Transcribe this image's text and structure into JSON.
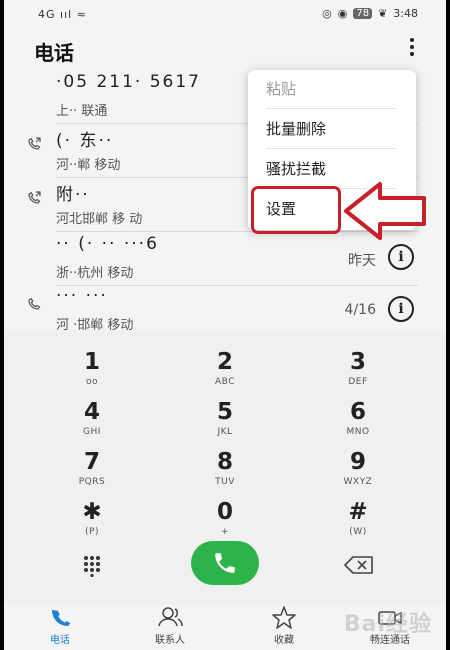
{
  "status_bar": {
    "left": "4G ııl ≈",
    "battery": "78",
    "time": "3:48"
  },
  "app": {
    "title": "电话"
  },
  "calls": [
    {
      "number": "·05 211· 5617",
      "location": "上·· 联通",
      "date": ""
    },
    {
      "number": "(· 东··",
      "location": "河··郸 移动",
      "date": ""
    },
    {
      "number": "附··",
      "location": "河北邯郸 移 动",
      "date": ""
    },
    {
      "number": "·· (· ·· ···6",
      "location": "浙··杭州 移动",
      "date": "昨天"
    },
    {
      "number": "··· ···",
      "location": "河 ·邯郸 移动",
      "date": "4/16"
    }
  ],
  "menu": {
    "items": [
      {
        "label": "粘贴",
        "disabled": true
      },
      {
        "label": "批量删除"
      },
      {
        "label": "骚扰拦截"
      },
      {
        "label": "设置"
      }
    ]
  },
  "keypad": [
    {
      "digit": "1",
      "letters": "oo"
    },
    {
      "digit": "2",
      "letters": "ABC"
    },
    {
      "digit": "3",
      "letters": "DEF"
    },
    {
      "digit": "4",
      "letters": "GHI"
    },
    {
      "digit": "5",
      "letters": "JKL"
    },
    {
      "digit": "6",
      "letters": "MNO"
    },
    {
      "digit": "7",
      "letters": "PQRS"
    },
    {
      "digit": "8",
      "letters": "TUV"
    },
    {
      "digit": "9",
      "letters": "WXYZ"
    },
    {
      "digit": "✱",
      "letters": "(P)"
    },
    {
      "digit": "0",
      "letters": "+"
    },
    {
      "digit": "#",
      "letters": "(W)"
    }
  ],
  "tabs": [
    {
      "label": "电话",
      "icon": "phone-icon",
      "active": true
    },
    {
      "label": "联系人",
      "icon": "contacts-icon"
    },
    {
      "label": "收藏",
      "icon": "star-icon"
    },
    {
      "label": "畅连通话",
      "icon": "video-call-icon"
    }
  ],
  "watermark": "Bai经验",
  "colors": {
    "accent": "#1e7fd6",
    "call_button": "#2db34a",
    "annotation": "#c8202b"
  }
}
